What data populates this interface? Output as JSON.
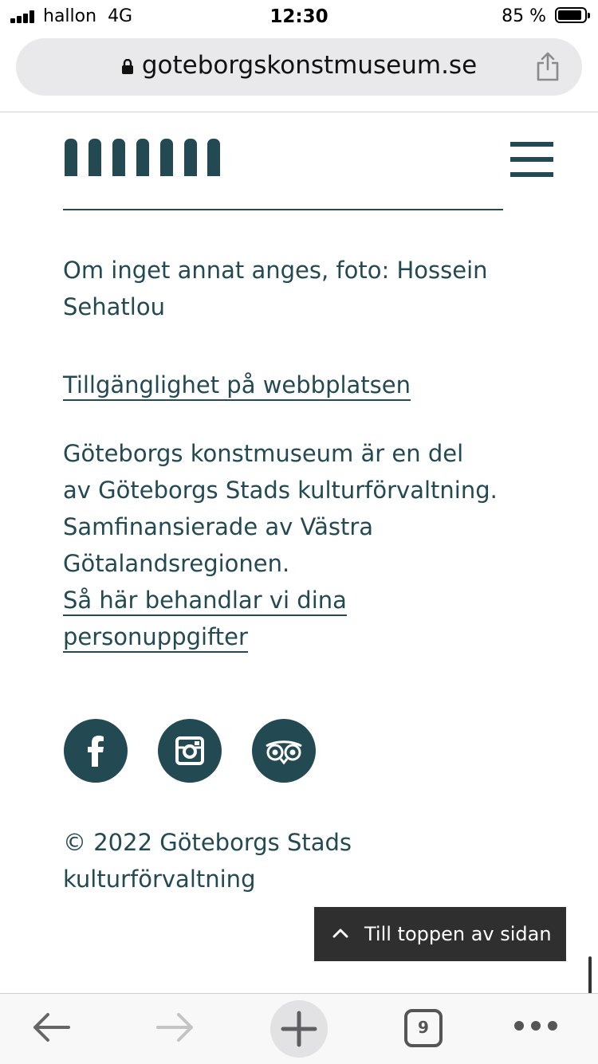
{
  "status_bar": {
    "carrier": "hallon",
    "network": "4G",
    "time": "12:30",
    "battery_percent": "85 %",
    "battery_level": 0.85
  },
  "browser": {
    "url": "goteborgskonstmuseum.se",
    "tab_count": "9"
  },
  "footer": {
    "photo_credit": "Om inget annat anges, foto: Hossein Sehatlou",
    "accessibility_link": "Tillgänglighet på webbplatsen",
    "about_line1": "Göteborgs konstmuseum är en del",
    "about_line2": "av Göteborgs Stads kulturförvaltning.",
    "about_line3": "Samfinansierade av Västra",
    "about_line4": "Götalandsregionen.",
    "privacy_link_line1": "Så här behandlar vi dina",
    "privacy_link_line2": "personuppgifter",
    "social": [
      {
        "icon": "facebook-icon"
      },
      {
        "icon": "instagram-icon"
      },
      {
        "icon": "tripadvisor-icon"
      }
    ],
    "copyright_line1": "© 2022 Göteborgs Stads",
    "copyright_line2": "kulturförvaltning"
  },
  "back_to_top": {
    "label": "Till toppen av sidan"
  },
  "colors": {
    "brand": "#234a53",
    "back_to_top_bg": "#2f2f2f"
  }
}
